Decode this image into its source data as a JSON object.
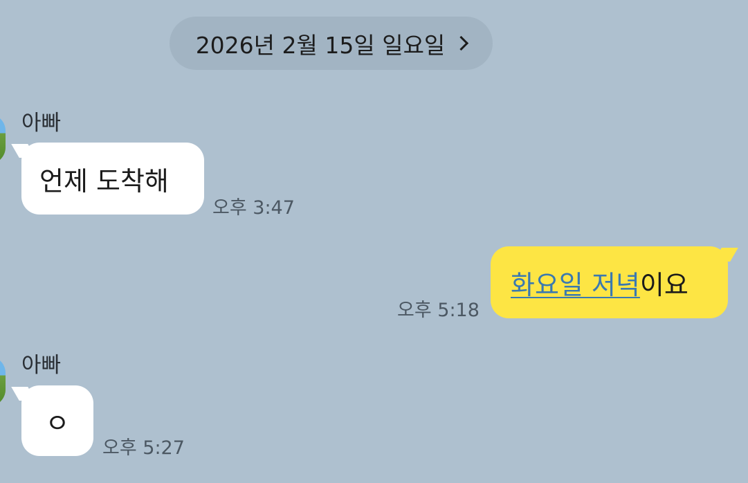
{
  "date_separator": {
    "label": "2026년 2월 15일 일요일"
  },
  "messages": [
    {
      "sender": "아빠",
      "text": "언제 도착해",
      "time": "오후 3:47",
      "direction": "incoming"
    },
    {
      "link_text": "화요일 저녁",
      "text_after_link": "이요",
      "time": "오후 5:18",
      "direction": "outgoing"
    },
    {
      "sender": "아빠",
      "text": "ㅇ",
      "time": "오후 5:27",
      "direction": "incoming"
    }
  ],
  "colors": {
    "background": "#aec0cf",
    "date_pill": "#a2b4c3",
    "incoming_bubble": "#ffffff",
    "outgoing_bubble": "#fde544",
    "link": "#3a79b0",
    "time_text": "#4c5863"
  },
  "icons": {
    "date_chevron": "chevron-right-icon",
    "avatar": "avatar"
  }
}
